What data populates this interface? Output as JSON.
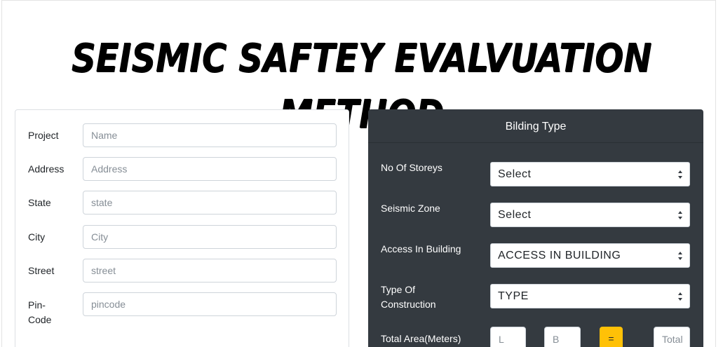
{
  "header": {
    "title": "SEISMIC SAFTEY EVALVUATION METHOD"
  },
  "address_form": {
    "fields": [
      {
        "label": "Project",
        "placeholder": "Name",
        "value": ""
      },
      {
        "label": "Address",
        "placeholder": "Address",
        "value": ""
      },
      {
        "label": "State",
        "placeholder": "state",
        "value": ""
      },
      {
        "label": "City",
        "placeholder": "City",
        "value": ""
      },
      {
        "label": "Street",
        "placeholder": "street",
        "value": ""
      },
      {
        "label_line1": "Pin-",
        "label_line2": "Code",
        "placeholder": "pincode",
        "value": ""
      }
    ]
  },
  "building": {
    "title": "Bilding Type",
    "storeys": {
      "label": "No Of Storeys",
      "selected": "Select"
    },
    "zone": {
      "label": "Seismic Zone",
      "selected": "Select"
    },
    "access": {
      "label": "Access In Building",
      "selected": "ACCESS IN BUILDING"
    },
    "construction": {
      "label_line1": "Type Of",
      "label_line2": "Construction",
      "selected": "TYPE"
    },
    "area": {
      "label": "Total Area(Meters)",
      "length_placeholder": "L",
      "breadth_placeholder": "B",
      "equals_label": "=",
      "total_placeholder": "Total"
    }
  },
  "colors": {
    "dark_card": "#343a40",
    "accent_button": "#ffc107",
    "border": "#ced4da"
  },
  "icons": {
    "select_arrow": "up-down-caret-icon"
  }
}
